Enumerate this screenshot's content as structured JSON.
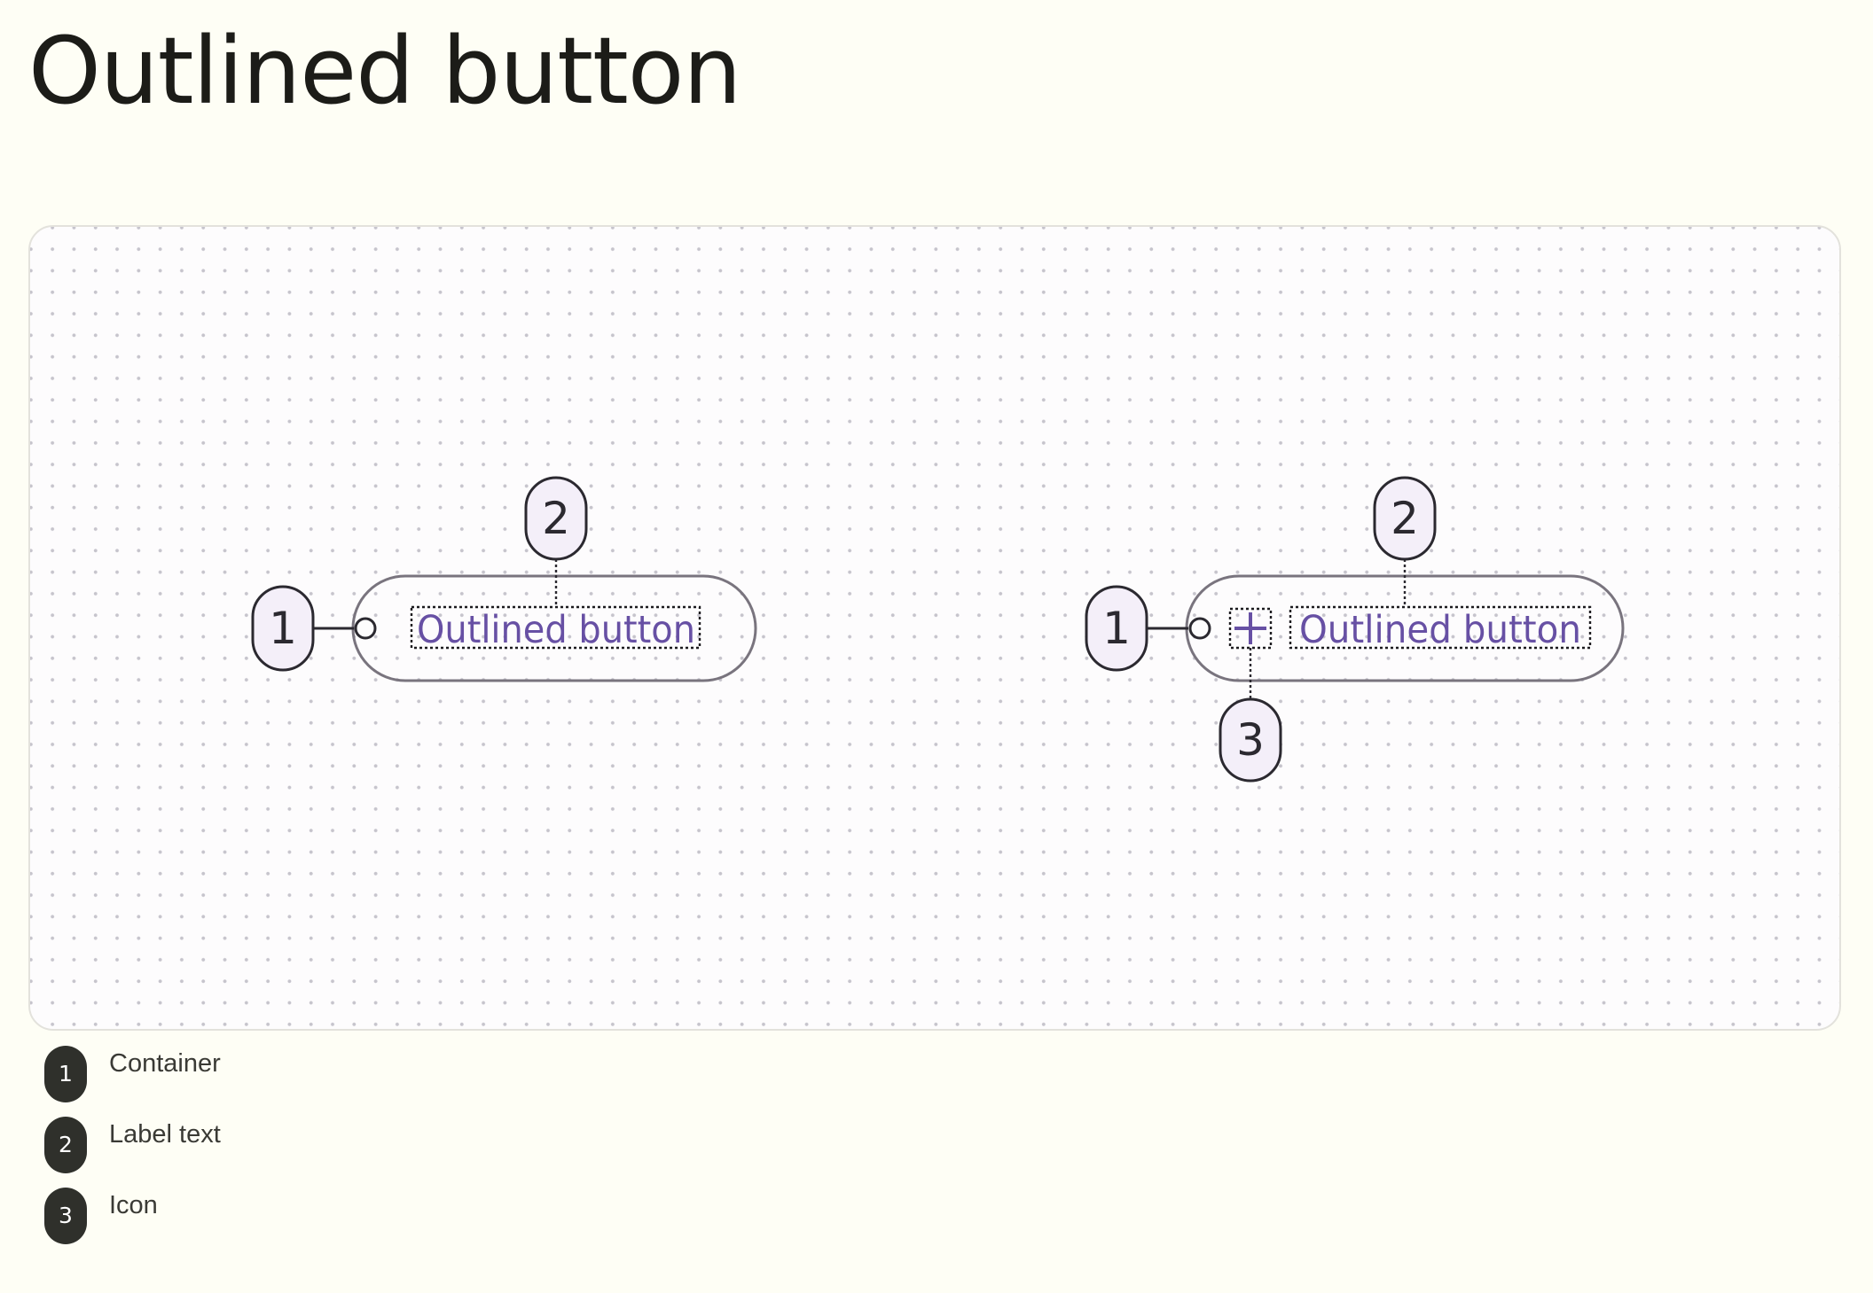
{
  "page": {
    "title": "Outlined button"
  },
  "diagram": {
    "buttons": [
      {
        "label": "Outlined button",
        "has_icon": false,
        "icon": null,
        "markers": {
          "container": "1",
          "label": "2"
        }
      },
      {
        "label": "Outlined button",
        "has_icon": true,
        "icon": "plus-icon",
        "markers": {
          "container": "1",
          "label": "2",
          "icon": "3"
        }
      }
    ]
  },
  "legend": {
    "items": [
      {
        "number": "1",
        "label": "Container"
      },
      {
        "number": "2",
        "label": "Label text"
      },
      {
        "number": "3",
        "label": "Icon"
      }
    ]
  },
  "colors": {
    "background": "#fefef5",
    "canvas": "#fdfcfd",
    "primary": "#6750a4",
    "outline": "#79747e",
    "marker_fill": "#f4eff9",
    "marker_stroke": "#2b2930",
    "legend_badge": "#2f302b"
  }
}
